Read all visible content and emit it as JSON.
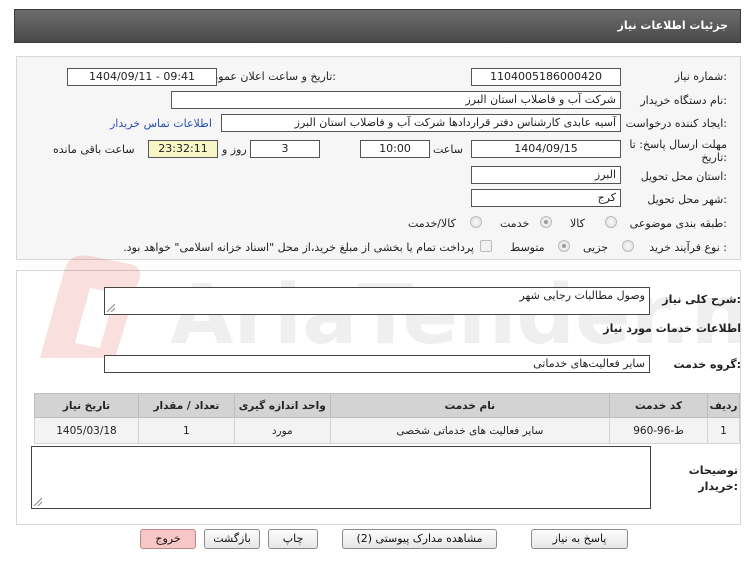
{
  "header": {
    "title": "جزئیات اطلاعات نیاز"
  },
  "form": {
    "need_number_label": "شماره نیاز:",
    "need_number": "1104005186000420",
    "announce_label": "تاریخ و ساعت اعلان عمومی:",
    "announce_value": "1404/09/11 - 09:41",
    "buyer_org_label": "نام دستگاه خریدار:",
    "buyer_org": "شرکت آب و فاضلاب استان البرز",
    "creator_label": "ایجاد کننده درخواست:",
    "creator": "آسیه عابدی کارشناس دفتر قراردادها شرکت آب و فاضلاب استان البرز",
    "contact_link": "اطلاعات تماس خریدار",
    "deadline_label_1": "مهلت ارسال پاسخ: تا",
    "deadline_label_2": "تاریخ:",
    "deadline_date": "1404/09/15",
    "time_label": "ساعت",
    "deadline_time": "10:00",
    "days": "3",
    "days_label": "روز و",
    "remaining": "23:32:11",
    "remaining_label": "ساعت باقی مانده",
    "province_label": "استان محل تحویل:",
    "province": "البرز",
    "city_label": "شهر محل تحویل:",
    "city": "کرج",
    "category_label": "طبقه بندی موضوعی:",
    "category_options": [
      "کالا",
      "خدمت",
      "کالا/خدمت"
    ],
    "purchase_type_label": "نوع فرآیند خرید :",
    "purchase_options": [
      "جزیی",
      "متوسط"
    ],
    "payment_note": "پرداخت تمام یا بخشی از مبلغ خرید،از محل \"اسناد خزانه اسلامی\" خواهد بود."
  },
  "summary": {
    "label": "شرح کلی نیاز:",
    "value": "وصول مطالبات رجایی شهر",
    "services_title": "اطلاعات خدمات مورد نیاز",
    "group_label": "گروه خدمت:",
    "group_value": "سایر فعالیت‌های خدماتی"
  },
  "table": {
    "headers": [
      "ردیف",
      "کد خدمت",
      "نام خدمت",
      "واحد اندازه گیری",
      "تعداد / مقدار",
      "تاریخ نیاز"
    ],
    "rows": [
      [
        "1",
        "ط-96-960",
        "سایر فعالیت های خدماتی شخصی",
        "مورد",
        "1",
        "1405/03/18"
      ]
    ]
  },
  "notes": {
    "label_1": "توضیحات",
    "label_2": "خریدار:"
  },
  "buttons": {
    "reply": "پاسخ به نیاز",
    "attachments": "مشاهده مدارک پیوستی (2)",
    "print": "چاپ",
    "back": "بازگشت",
    "exit": "خروج"
  },
  "watermark": {
    "text": "AriaTender.net"
  },
  "colors": {
    "header_bg": "#5a5a5a",
    "link": "#2a4fb5",
    "remaining_bg": "#f6f6c6",
    "exit_bg": "#f7c6c6"
  }
}
